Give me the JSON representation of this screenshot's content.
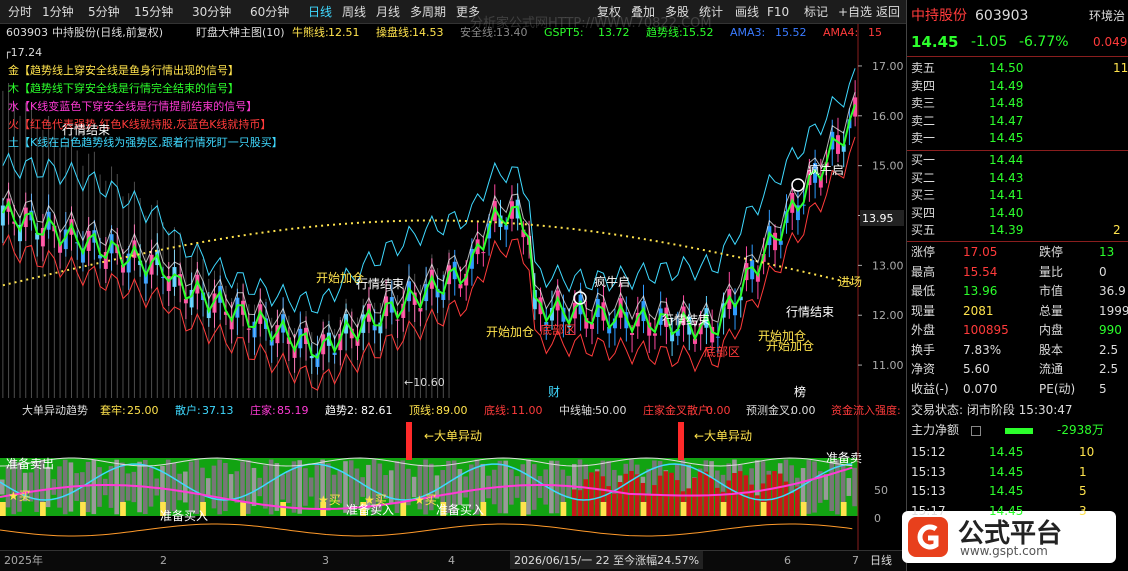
{
  "toolbar": {
    "periods": [
      "分时",
      "1分钟",
      "5分钟",
      "15分钟",
      "30分钟",
      "60分钟",
      "日线",
      "周线",
      "月线",
      "多周期",
      "更多"
    ],
    "active_period": "日线",
    "actions": [
      "复权",
      "叠加",
      "多股",
      "统计",
      "画线",
      "F10",
      "标记",
      "+自选",
      "返回"
    ]
  },
  "main_panel": {
    "code": "603903",
    "name": "中持股份(日线,前复权)",
    "indicator": "盯盘大神主图(10)",
    "metrics": [
      {
        "label": "牛熊线:",
        "value": "12.51",
        "color": "#ffe34d"
      },
      {
        "label": "操盘线:",
        "value": "14.53",
        "color": "#ffe34d"
      },
      {
        "label": "安全线:",
        "value": "13.40",
        "color": "#888888"
      },
      {
        "label": "GSPT5:",
        "value": "13.72",
        "color": "#2cff2c"
      },
      {
        "label": "趋势线:",
        "value": "15.52",
        "color": "#2cff2c"
      },
      {
        "label": "AMA3:",
        "value": "15.52",
        "color": "#3a7bff"
      },
      {
        "label": "AMA4:",
        "value": "15",
        "color": "#ff3b3b"
      }
    ],
    "high_mark": "17.24",
    "low_mark": "10.60",
    "legend_lines": [
      {
        "text": "金【趋势线上穿安全线是鱼身行情出现的信号】",
        "color": "#ffe34d"
      },
      {
        "text": "木【趋势线下穿安全线是行情完全结束的信号】",
        "color": "#2cff2c"
      },
      {
        "text": "水【K线变蓝色下穿安全线是行情提前结束的信号】",
        "color": "#ff3bd6"
      },
      {
        "text": "火【红色代表强势,红色K线就持股,灰蓝色K线就持币】",
        "color": "#ff3b3b"
      },
      {
        "text": "土【K线在白色趋势线为强势区,跟着行情死盯一只股买】",
        "color": "#3fd9ff"
      }
    ],
    "price_axis": [
      "17.00",
      "16.00",
      "15.00",
      "14.00",
      "13.00",
      "12.00",
      "11.00"
    ],
    "current_price_tag": "13.95",
    "annotations": [
      {
        "text": "行情结束",
        "color": "#ffffff"
      },
      {
        "text": "开始加仓",
        "color": "#ffe34d"
      },
      {
        "text": "行情结束",
        "color": "#ffffff"
      },
      {
        "text": "开始加仓",
        "color": "#ffe34d"
      },
      {
        "text": "疯牛启",
        "color": "#ffffff"
      },
      {
        "text": "疯牛启",
        "color": "#ffffff"
      },
      {
        "text": "底部区",
        "color": "#ff3b3b"
      },
      {
        "text": "行情结束",
        "color": "#ffffff"
      },
      {
        "text": "底部区",
        "color": "#ff3b3b"
      },
      {
        "text": "开始加仓",
        "color": "#ffe34d"
      },
      {
        "text": "行情结束",
        "color": "#ffffff"
      },
      {
        "text": "开始加仓",
        "color": "#ffe34d"
      },
      {
        "text": "进场",
        "color": "#ffe34d"
      },
      {
        "text": "财",
        "color": "#3fd9ff"
      },
      {
        "text": "榜",
        "color": "#ffffff"
      }
    ]
  },
  "sub_panel": {
    "name": "大单异动趋势",
    "metrics": [
      {
        "label": "套牢:",
        "value": "25.00",
        "color": "#ffe34d"
      },
      {
        "label": "散户:",
        "value": "37.13",
        "color": "#3fd9ff"
      },
      {
        "label": "庄家:",
        "value": "85.19",
        "color": "#ff3bd6"
      },
      {
        "label": "趋势2:",
        "value": "82.61",
        "color": "#ffffff"
      },
      {
        "label": "顶线:",
        "value": "89.00",
        "color": "#ffe34d"
      },
      {
        "label": "底线:",
        "value": "11.00",
        "color": "#ff3b3b"
      },
      {
        "label": "中线轴:",
        "value": "50.00",
        "color": "#dddddd"
      },
      {
        "label": "庄家金叉散户:",
        "value": "0.00",
        "color": "#ff3b3b"
      },
      {
        "label": "预测金叉:",
        "value": "0.00",
        "color": "#dddddd"
      },
      {
        "label": "资金流入强度:",
        "value": "",
        "color": "#ff3b3b"
      }
    ],
    "labels": [
      {
        "text": "大单异动",
        "color": "#ffe34d"
      },
      {
        "text": "大单异动",
        "color": "#ffe34d"
      },
      {
        "text": "准备卖出",
        "color": "#ffffff"
      },
      {
        "text": "准备卖",
        "color": "#ffffff"
      },
      {
        "text": "准备买入",
        "color": "#ffffff"
      },
      {
        "text": "准备买入",
        "color": "#ffffff"
      },
      {
        "text": "准备买入",
        "color": "#ffffff"
      },
      {
        "text": "★买",
        "color": "#ffe34d"
      },
      {
        "text": "★买",
        "color": "#ffe34d"
      },
      {
        "text": "★买",
        "color": "#ffe34d"
      },
      {
        "text": "★买",
        "color": "#ffe34d"
      }
    ],
    "axis": [
      "50",
      "0"
    ]
  },
  "bottom": {
    "year": "2025年",
    "months": [
      "2",
      "3",
      "4",
      "5",
      "6",
      "7"
    ],
    "date_info": "2026/06/15/一 22 至今涨幅24.57%",
    "period": "日线"
  },
  "quote": {
    "name": "中持股份",
    "code": "603903",
    "side_label": "环境治",
    "price": "14.45",
    "change": "-1.05",
    "pct": "-6.77%",
    "ratio": "0.049",
    "asks": [
      {
        "label": "卖五",
        "price": "14.50",
        "vol": "11"
      },
      {
        "label": "卖四",
        "price": "14.49",
        "vol": ""
      },
      {
        "label": "卖三",
        "price": "14.48",
        "vol": ""
      },
      {
        "label": "卖二",
        "price": "14.47",
        "vol": ""
      },
      {
        "label": "卖一",
        "price": "14.45",
        "vol": ""
      }
    ],
    "bids": [
      {
        "label": "买一",
        "price": "14.44",
        "vol": ""
      },
      {
        "label": "买二",
        "price": "14.43",
        "vol": ""
      },
      {
        "label": "买三",
        "price": "14.41",
        "vol": ""
      },
      {
        "label": "买四",
        "price": "14.40",
        "vol": ""
      },
      {
        "label": "买五",
        "price": "14.39",
        "vol": "2"
      }
    ],
    "stats": [
      {
        "l1": "涨停",
        "v1": "17.05",
        "c1": "#ff3b3b",
        "l2": "跌停",
        "v2": "13",
        "c2": "#2cff2c"
      },
      {
        "l1": "最高",
        "v1": "15.54",
        "c1": "#ff3b3b",
        "l2": "量比",
        "v2": "0",
        "c2": "#dddddd"
      },
      {
        "l1": "最低",
        "v1": "13.96",
        "c1": "#2cff2c",
        "l2": "市值",
        "v2": "36.9",
        "c2": "#dddddd"
      },
      {
        "l1": "现量",
        "v1": "2081",
        "c1": "#ffe34d",
        "l2": "总量",
        "v2": "1999",
        "c2": "#dddddd"
      },
      {
        "l1": "外盘",
        "v1": "100895",
        "c1": "#ff3b3b",
        "l2": "内盘",
        "v2": "990",
        "c2": "#2cff2c"
      },
      {
        "l1": "换手",
        "v1": "7.83%",
        "c1": "#dddddd",
        "l2": "股本",
        "v2": "2.5",
        "c2": "#dddddd"
      },
      {
        "l1": "净资",
        "v1": "5.60",
        "c1": "#dddddd",
        "l2": "流通",
        "v2": "2.5",
        "c2": "#dddddd"
      },
      {
        "l1": "收益(-)",
        "v1": "0.070",
        "c1": "#dddddd",
        "l2": "PE(动)",
        "v2": "5",
        "c2": "#dddddd"
      }
    ],
    "status": "交易状态: 闭市阶段 15:30:47",
    "net_label": "主力净额",
    "net_value": "-2938万",
    "ticks": [
      {
        "time": "15:12",
        "price": "14.45",
        "vol": "10"
      },
      {
        "time": "15:13",
        "price": "14.45",
        "vol": "1"
      },
      {
        "time": "15:13",
        "price": "14.45",
        "vol": "5"
      },
      {
        "time": "15:17",
        "price": "14.45",
        "vol": "3"
      }
    ]
  },
  "watermark": "分析家公式网HTTP://WWW.70822.COM",
  "logo": {
    "text": "公式平台",
    "url": "www.gspt.com"
  }
}
